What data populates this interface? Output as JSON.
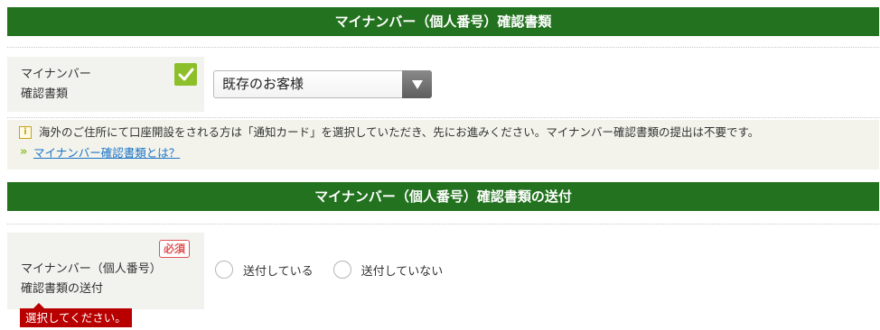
{
  "section1": {
    "title": "マイナンバー（個人番号）確認書類",
    "field_label_line1": "マイナンバー",
    "field_label_line2": "確認書類",
    "checked_icon": "checkmark-icon",
    "select_value": "既存のお客様",
    "info_icon": "info-icon",
    "info_text": "海外のご住所にて口座開設をされる方は「通知カード」を選択していただき、先にお進みください。マイナンバー確認書類の提出は不要です。",
    "info_arrow": "»",
    "info_link": "マイナンバー確認書類とは？"
  },
  "section2": {
    "title": "マイナンバー（個人番号）確認書類の送付",
    "required_badge": "必須",
    "field_label_line1": "マイナンバー（個人番号）",
    "field_label_line2": "確認書類の送付",
    "radio_options": [
      "送付している",
      "送付していない"
    ],
    "error_tooltip": "選択してください。"
  },
  "colors": {
    "header_green": "#23721f",
    "check_green": "#8dbf2a",
    "link_blue": "#1a73c6",
    "required_red": "#e05353",
    "error_red": "#b80000"
  }
}
